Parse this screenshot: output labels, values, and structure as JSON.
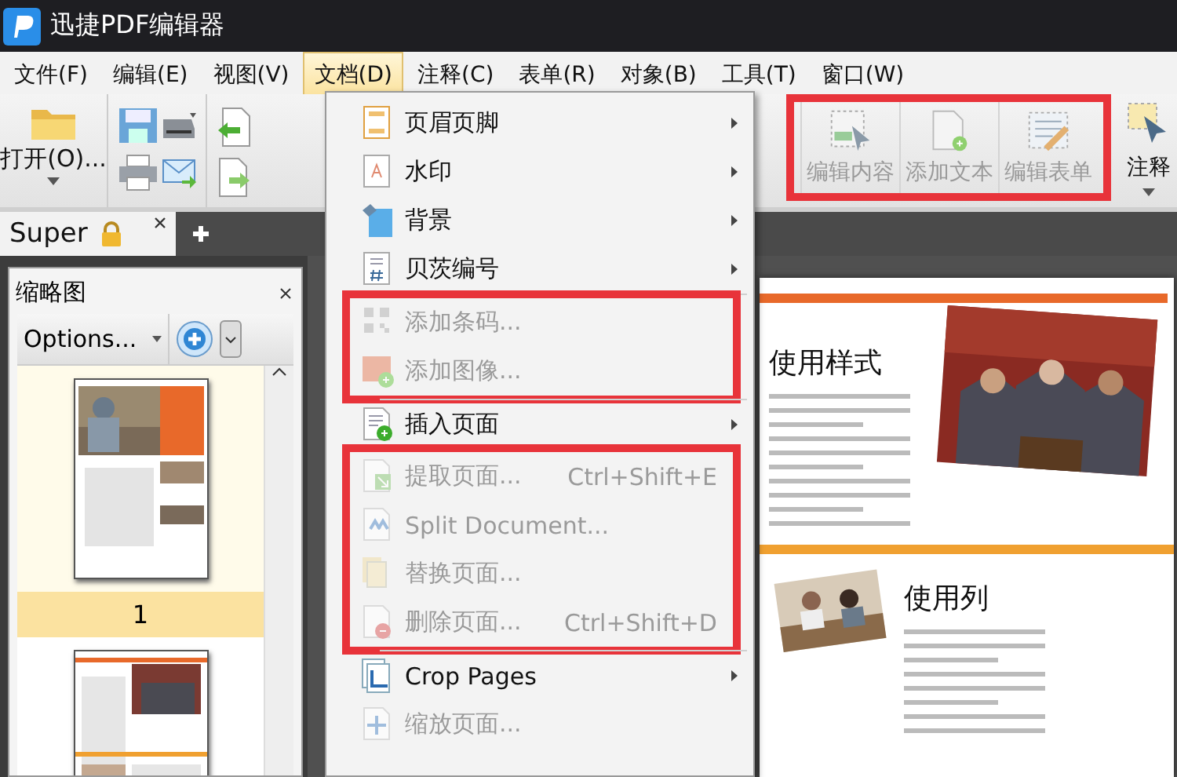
{
  "window": {
    "title": "迅捷PDF编辑器"
  },
  "menubar": [
    {
      "label": "文件(F)",
      "selected": false
    },
    {
      "label": "编辑(E)",
      "selected": false
    },
    {
      "label": "视图(V)",
      "selected": false
    },
    {
      "label": "文档(D)",
      "selected": true
    },
    {
      "label": "注释(C)",
      "selected": false
    },
    {
      "label": "表单(R)",
      "selected": false
    },
    {
      "label": "对象(B)",
      "selected": false
    },
    {
      "label": "工具(T)",
      "selected": false
    },
    {
      "label": "窗口(W)",
      "selected": false
    }
  ],
  "toolbar": {
    "open": {
      "label": "打开(O)..."
    },
    "tools": [
      {
        "label": "编辑内容",
        "disabled": true,
        "boxed": true
      },
      {
        "label": "添加文本",
        "disabled": true,
        "boxed": true
      },
      {
        "label": "编辑表单",
        "disabled": true,
        "boxed": true
      },
      {
        "label": "注释",
        "disabled": false,
        "boxed": false
      }
    ]
  },
  "tabs": [
    {
      "label": "Super",
      "selected": true,
      "locked": true
    }
  ],
  "thumbnails": {
    "title": "缩略图",
    "options": "Options...",
    "pages": [
      {
        "label": "1",
        "selected": true
      },
      {
        "selected": false
      }
    ]
  },
  "document": {
    "sections": [
      {
        "heading": "使用样式"
      },
      {
        "heading": "使用列"
      }
    ]
  },
  "menu": {
    "items": [
      {
        "kind": "item",
        "label": "页眉页脚",
        "submenu": true,
        "disabled": false,
        "boxed": false
      },
      {
        "kind": "item",
        "label": "水印",
        "submenu": true,
        "disabled": false,
        "boxed": false
      },
      {
        "kind": "item",
        "label": "背景",
        "submenu": true,
        "disabled": false,
        "boxed": false
      },
      {
        "kind": "item",
        "label": "贝茨编号",
        "submenu": true,
        "disabled": false,
        "boxed": false
      },
      {
        "kind": "separator"
      },
      {
        "kind": "item",
        "label": "添加条码...",
        "submenu": false,
        "disabled": true,
        "boxed": true
      },
      {
        "kind": "item",
        "label": "添加图像...",
        "submenu": false,
        "disabled": true,
        "boxed": true
      },
      {
        "kind": "separator"
      },
      {
        "kind": "item",
        "label": "插入页面",
        "submenu": true,
        "disabled": false,
        "boxed": false
      },
      {
        "kind": "item",
        "label": "提取页面...",
        "shortcut": "Ctrl+Shift+E",
        "submenu": false,
        "disabled": true,
        "boxed": true
      },
      {
        "kind": "item",
        "label": "Split Document...",
        "submenu": false,
        "disabled": true,
        "boxed": true
      },
      {
        "kind": "item",
        "label": "替换页面...",
        "submenu": false,
        "disabled": true,
        "boxed": true
      },
      {
        "kind": "item",
        "label": "删除页面...",
        "shortcut": "Ctrl+Shift+D",
        "submenu": false,
        "disabled": true,
        "boxed": true
      },
      {
        "kind": "separator"
      },
      {
        "kind": "item",
        "label": "Crop Pages",
        "submenu": true,
        "disabled": false,
        "boxed": false
      },
      {
        "kind": "item",
        "label": "缩放页面...",
        "submenu": false,
        "disabled": true,
        "boxed": false
      }
    ]
  }
}
